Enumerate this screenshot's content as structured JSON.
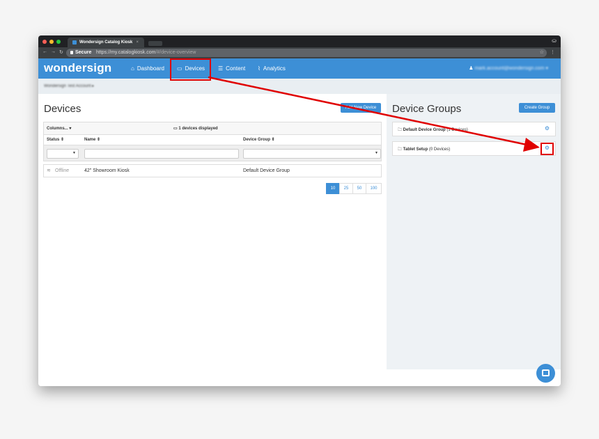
{
  "browser": {
    "tab_title": "Wondersign Catalog Kiosk",
    "tab_close": "×",
    "secure_label": "Secure",
    "url_domain": "https://my.catalogkiosk.com",
    "url_path": "/#/device-overview"
  },
  "nav": {
    "brand": "wondersign",
    "items": [
      "Dashboard",
      "Devices",
      "Content",
      "Analytics"
    ],
    "user_email": "mark.account@wondersign.com ▾"
  },
  "breadcrumb": {
    "account": "Wondersign Test Account ▸"
  },
  "devices": {
    "title": "Devices",
    "add_button": "Add New Device",
    "columns_label": "Columns... ▾",
    "count_label": "1 devices displayed",
    "headers": [
      "Status ⇕",
      "Name ⇕",
      "Device Group ⇕"
    ],
    "rows": [
      {
        "status": "Offline",
        "name": "42\" Showroom Kiosk",
        "group": "Default Device Group"
      }
    ],
    "page_sizes": [
      "10",
      "25",
      "50",
      "100"
    ],
    "active_page_size": "10"
  },
  "device_groups": {
    "title": "Device Groups",
    "create_button": "Create Group",
    "groups": [
      {
        "name": "Default Device Group",
        "count": "(1 Devices)"
      },
      {
        "name": "Tablet Setup",
        "count": "(0 Devices)"
      }
    ]
  },
  "colors": {
    "accent": "#3d8fd6",
    "highlight": "#e00000"
  }
}
